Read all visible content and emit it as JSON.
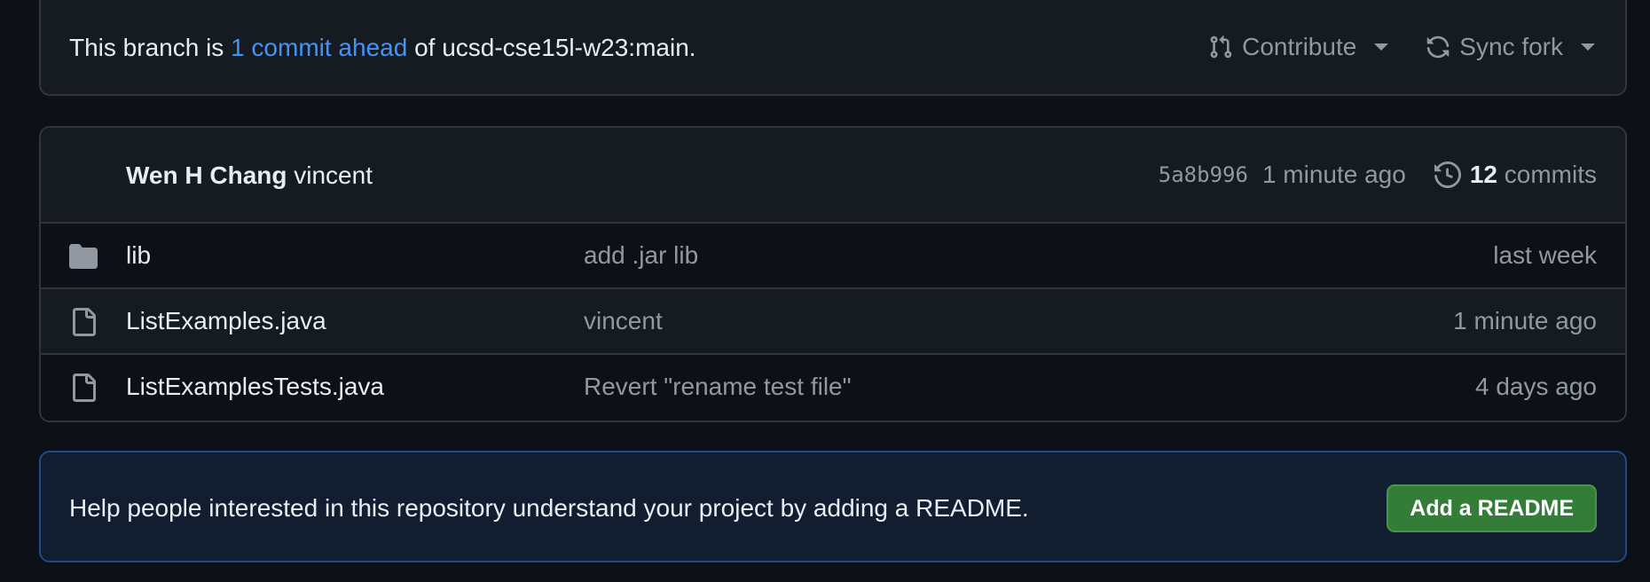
{
  "branch_status": {
    "prefix": "This branch is ",
    "link_text": "1 commit ahead",
    "suffix": " of ucsd-cse15l-w23:main.",
    "contribute_label": "Contribute",
    "sync_label": "Sync fork"
  },
  "latest_commit": {
    "author": "Wen H Chang",
    "message": "vincent",
    "sha": "5a8b996",
    "time": "1 minute ago",
    "commits_count": "12",
    "commits_label": "commits"
  },
  "files": [
    {
      "type": "folder",
      "icon": "folder-icon",
      "name": "lib",
      "message": "add .jar lib",
      "time": "last week"
    },
    {
      "type": "file",
      "icon": "file-icon",
      "name": "ListExamples.java",
      "message": "vincent",
      "time": "1 minute ago"
    },
    {
      "type": "file",
      "icon": "file-icon",
      "name": "ListExamplesTests.java",
      "message": "Revert \"rename test file\"",
      "time": "4 days ago"
    }
  ],
  "readme_banner": {
    "text": "Help people interested in this repository understand your project by adding a README.",
    "button_label": "Add a README"
  },
  "colors": {
    "background": "#0d1117",
    "panel": "#161b22",
    "border": "#30363d",
    "link": "#4493f8",
    "muted": "#9198a1",
    "readme_bg": "#121d2f",
    "button_green": "#347d39"
  }
}
